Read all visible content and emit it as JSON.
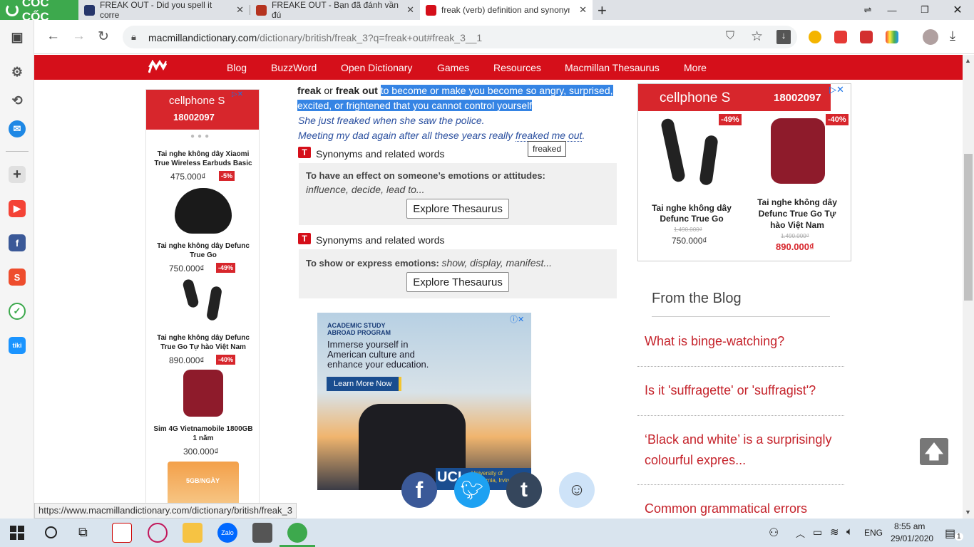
{
  "browser": {
    "logo_text": "CỐC CỐC",
    "tabs": [
      {
        "title": "FREAK OUT - Did you spell it corre"
      },
      {
        "title": "FREAKE OUT - Bạn đã đánh vần đú"
      },
      {
        "title": "freak (verb) definition and synonym"
      }
    ],
    "new_tab": "+",
    "url_domain": "macmillandictionary.com",
    "url_path": "/dictionary/british/freak_3?q=freak+out#freak_3__1",
    "status_url": "https://www.macmillandictionary.com/dictionary/british/freak_3"
  },
  "site_nav": {
    "items": [
      "Blog",
      "BuzzWord",
      "Open Dictionary",
      "Games",
      "Resources",
      "Macmillan Thesaurus",
      "More"
    ]
  },
  "left_ad": {
    "brand": "cellphone S",
    "phone": "18002097",
    "products": [
      {
        "name": "Tai nghe không dây Xiaomi True Wireless Earbuds Basic",
        "price": "475.000₫",
        "discount": "-5%"
      },
      {
        "name": "Tai nghe không dây Defunc True Go",
        "price": "750.000₫",
        "discount": "-49%"
      },
      {
        "name": "Tai nghe không dây Defunc True Go Tự hào Việt Nam",
        "price": "890.000₫",
        "discount": "-40%"
      },
      {
        "name": "Sim 4G Vietnamobile 1800GB 1 năm",
        "price": "300.000₫",
        "discount": ""
      }
    ],
    "sim_label": "5GB/NGÀY"
  },
  "definition": {
    "term1": "freak",
    "or": "or",
    "term2": "freak out",
    "meaning": "to become or make you become so angry, surprised, excited, or frightened that you cannot control yourself",
    "example1": "She just freaked when she saw the police.",
    "example2_pre": "Meeting my dad again after all these years really ",
    "example2_link": "freaked me out",
    "example2_post": ".",
    "tooltip": "freaked",
    "syn_heading": "Synonyms and related words",
    "syn1_title": "To have an effect on someone’s emotions or attitudes:",
    "syn1_words": "influence, decide, lead to...",
    "syn2_title": "To show or express emotions:",
    "syn2_words": "show, display, manifest...",
    "thesaurus_button": "Explore Thesaurus"
  },
  "center_ad": {
    "kicker": "ACADEMIC STUDY ABROAD PROGRAM",
    "headline": "Immerse yourself in American culture and enhance your education.",
    "cta": "Learn More Now",
    "logo": "UCI",
    "logo_sub": "University of California, Irvine"
  },
  "right_ad": {
    "brand": "cellphone S",
    "phone": "18002097",
    "products": [
      {
        "name": "Tai nghe không dây Defunc True Go",
        "old_price": "1.490.000₫",
        "price": "750.000₫",
        "discount": "-49%"
      },
      {
        "name": "Tai nghe không dây Defunc True Go Tự hào Việt Nam",
        "old_price": "1.490.000₫",
        "price": "890.000₫",
        "discount": "-40%"
      }
    ]
  },
  "blog": {
    "heading": "From the Blog",
    "posts": [
      "What is binge-watching?",
      "Is it 'suffragette' or 'suffragist'?",
      "‘Black and white’ is a surprisingly colourful expres...",
      "Common grammatical errors"
    ]
  },
  "taskbar": {
    "language": "ENG",
    "time": "8:55 am",
    "date": "29/01/2020",
    "notifications": "1"
  },
  "colors": {
    "macmillan_red": "#d50f1a",
    "coccoc_green": "#3da94d",
    "selection_blue": "#3584e4",
    "blog_link": "#c5232b"
  }
}
